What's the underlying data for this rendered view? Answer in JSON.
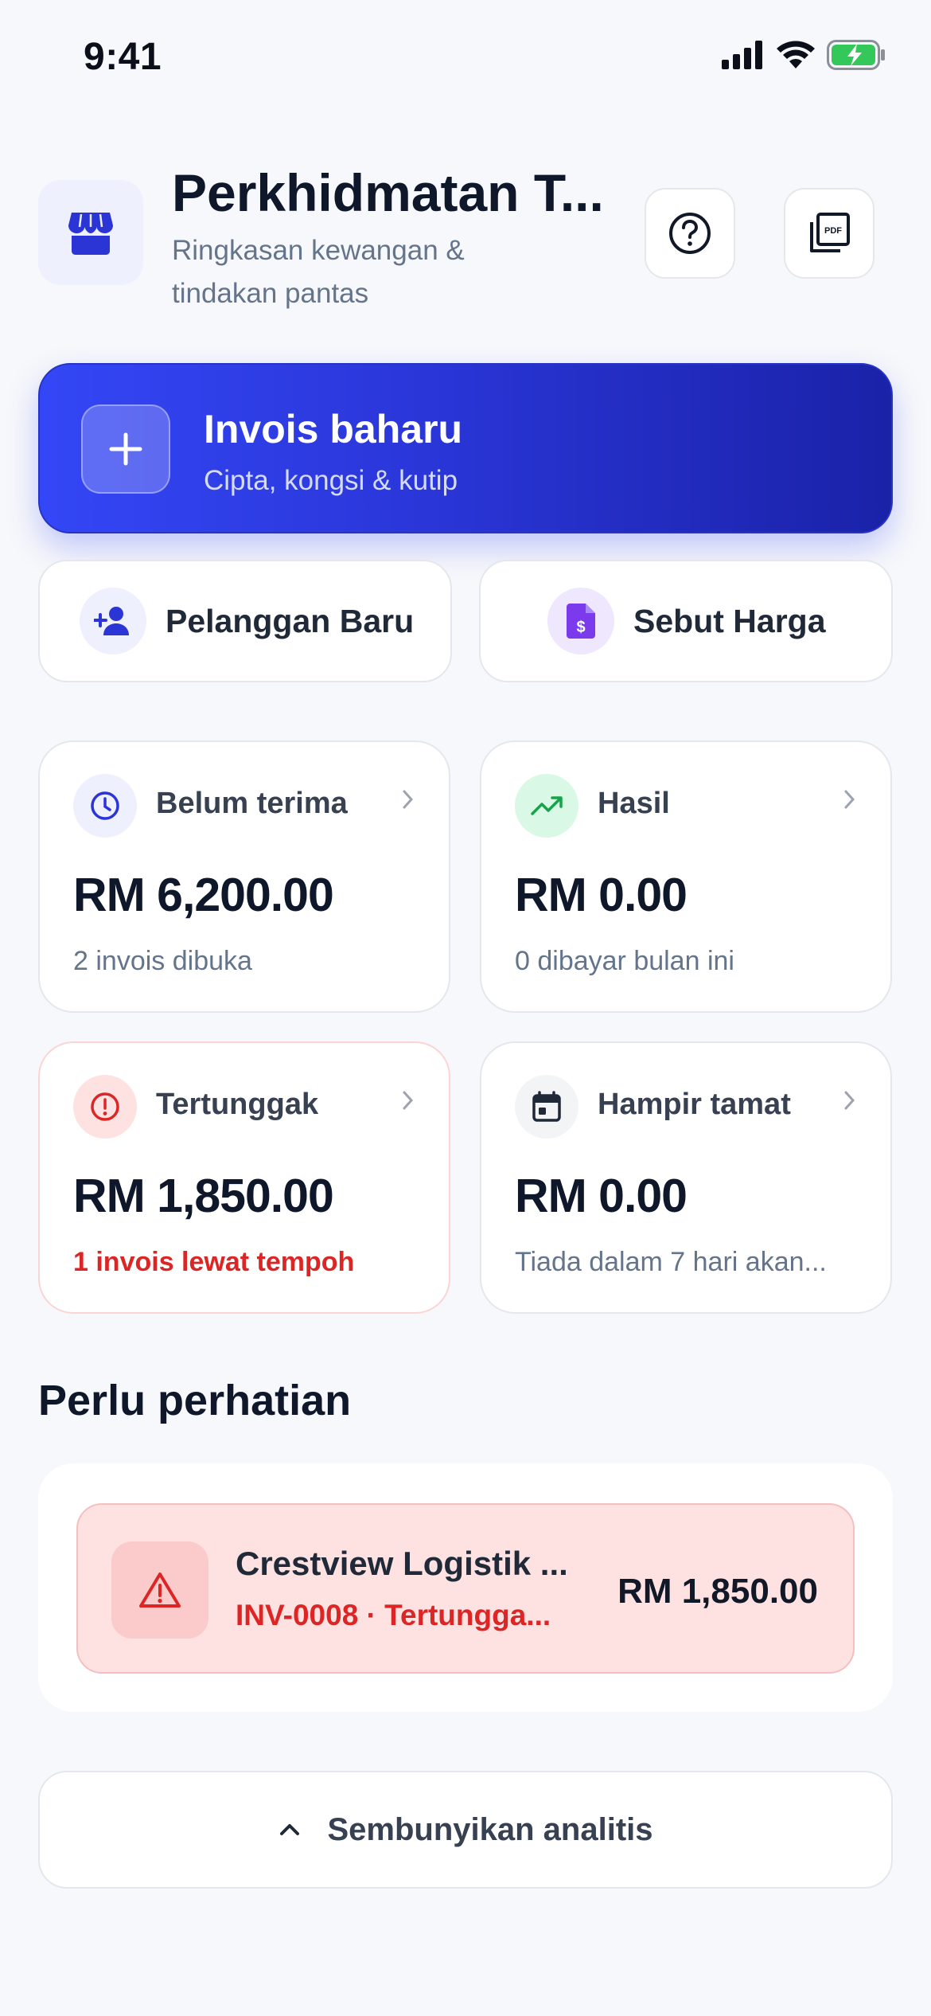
{
  "status_bar": {
    "time": "9:41"
  },
  "header": {
    "title": "Perkhidmatan T...",
    "subtitle": "Ringkasan kewangan & tindakan pantas"
  },
  "cta": {
    "title": "Invois baharu",
    "subtitle": "Cipta, kongsi & kutip"
  },
  "quick_actions": [
    {
      "label": "Pelanggan Baru",
      "icon": "add-person-icon"
    },
    {
      "label": "Sebut Harga",
      "icon": "quote-document-icon"
    }
  ],
  "stats": [
    {
      "label": "Belum terima",
      "value": "RM 6,200.00",
      "sub": "2 invois dibuka",
      "icon": "clock-icon"
    },
    {
      "label": "Hasil",
      "value": "RM 0.00",
      "sub": "0 dibayar bulan ini",
      "icon": "trending-up-icon"
    },
    {
      "label": "Tertunggak",
      "value": "RM 1,850.00",
      "sub": "1 invois lewat tempoh",
      "icon": "alert-circle-icon"
    },
    {
      "label": "Hampir tamat",
      "value": "RM 0.00",
      "sub": "Tiada dalam 7 hari akan...",
      "icon": "calendar-icon"
    }
  ],
  "attention": {
    "title": "Perlu perhatian",
    "items": [
      {
        "name": "Crestview Logistik ...",
        "meta": "INV-0008 · Tertungga...",
        "amount": "RM 1,850.00",
        "icon": "warning-triangle-icon"
      }
    ]
  },
  "hide_analytics": {
    "label": "Sembunyikan analitis"
  },
  "colors": {
    "accent": "#3447F6",
    "danger": "#DC2626",
    "success": "#16A34A",
    "background": "#F7F8FB"
  }
}
